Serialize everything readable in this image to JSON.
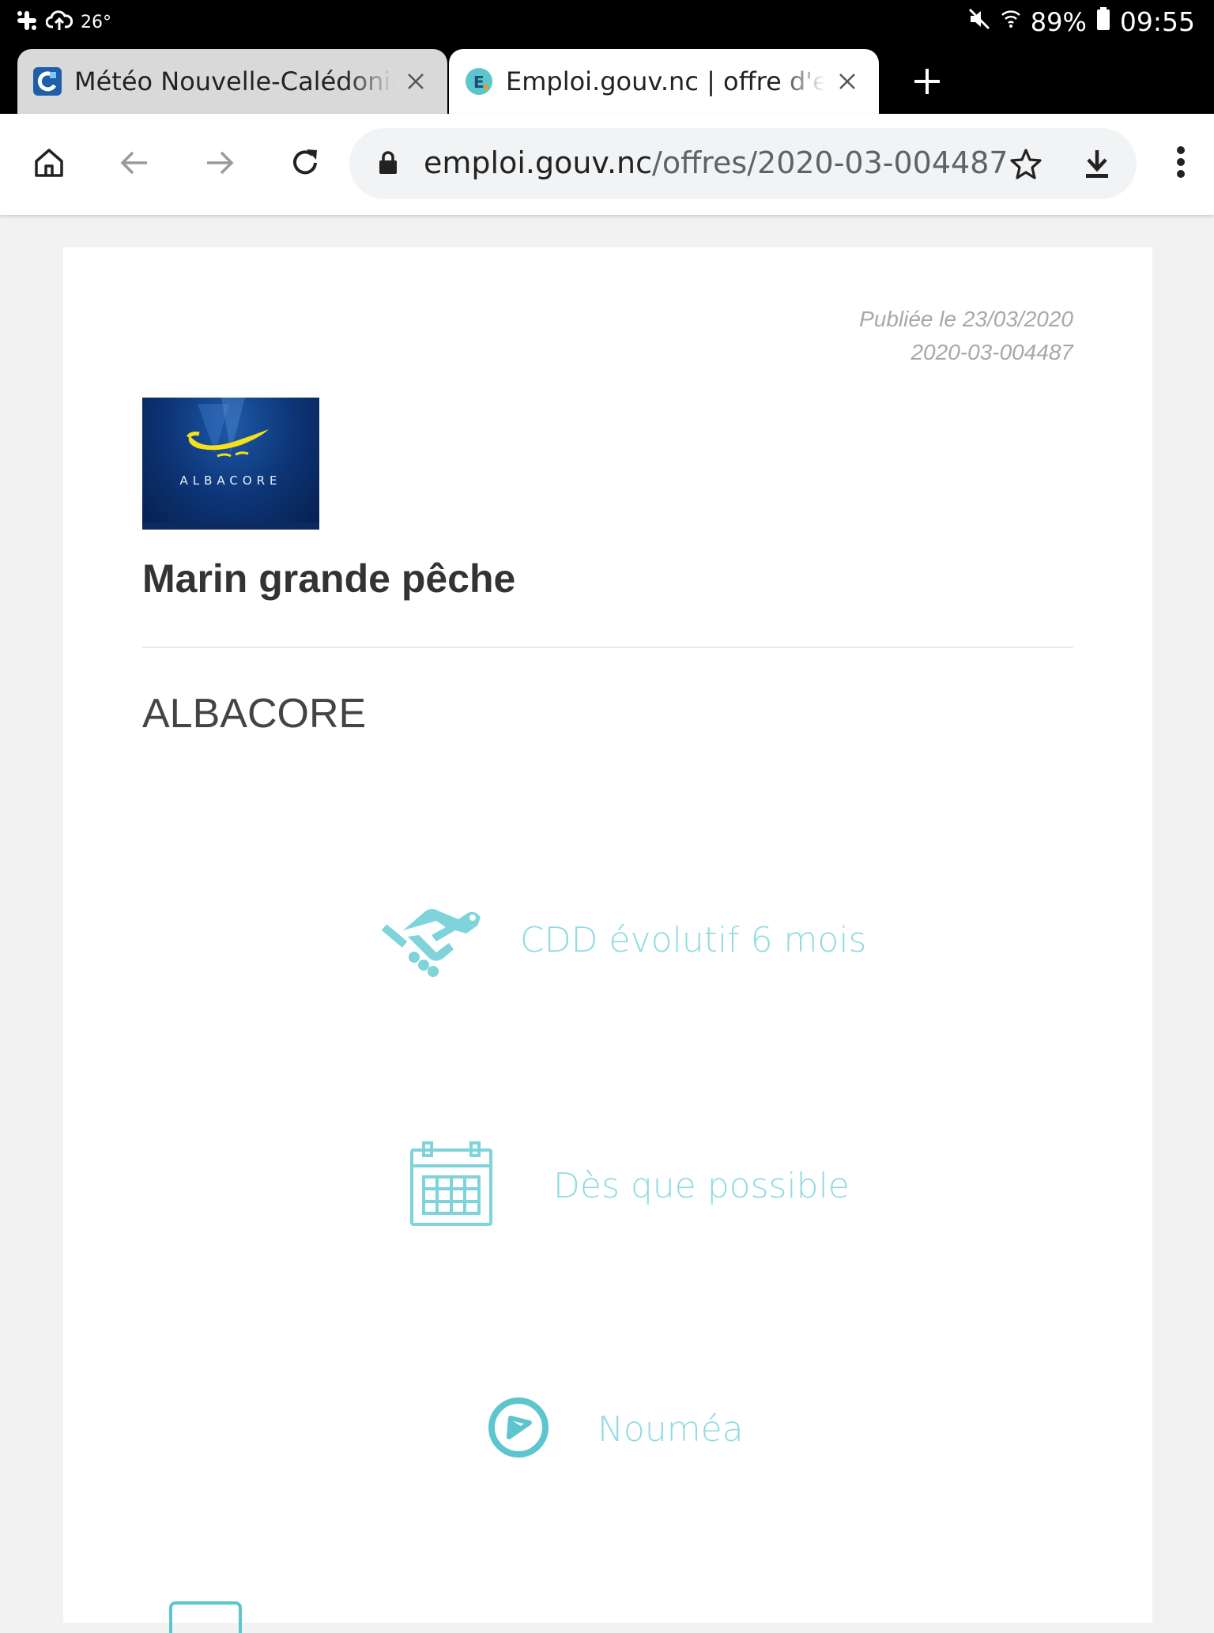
{
  "status_bar": {
    "temperature": "26°",
    "battery": "89%",
    "time": "09:55"
  },
  "tabs": [
    {
      "title": "Météo Nouvelle-Calédonie - ",
      "favicon": "meteo-favicon"
    },
    {
      "title": "Emploi.gouv.nc | offre d'emploi",
      "favicon": "emploi-favicon"
    }
  ],
  "toolbar": {
    "url_host": "emploi.gouv.nc",
    "url_path": "/offres/2020-03-004487"
  },
  "offer": {
    "published": "Publiée le 23/03/2020",
    "reference": "2020-03-004487",
    "logo_text": "ALBACORE",
    "title": "Marin grande pêche",
    "company": "ALBACORE",
    "contract": "CDD évolutif 6 mois",
    "start": "Dès que possible",
    "location": "Nouméa"
  },
  "colors": {
    "accent": "#5cc5cd",
    "accent_text": "#8fdbe0"
  }
}
